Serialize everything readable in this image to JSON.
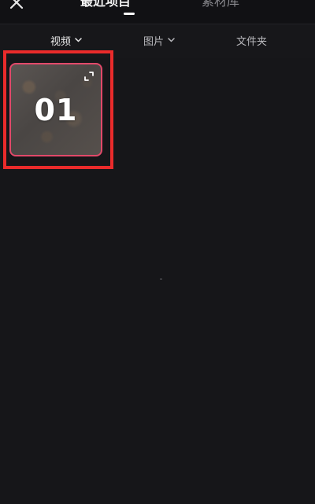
{
  "header": {
    "close_icon": "close-icon",
    "tabs": [
      {
        "label": "最近项目",
        "active": true
      },
      {
        "label": "素材库",
        "active": false
      }
    ]
  },
  "filters": [
    {
      "label": "视频",
      "active": true,
      "icon": "chevron-down-icon"
    },
    {
      "label": "图片",
      "active": false,
      "icon": "chevron-down-icon"
    },
    {
      "label": "文件夹",
      "active": false
    }
  ],
  "projects": [
    {
      "title": "01",
      "icon": "expand-icon",
      "selected": true
    }
  ],
  "colors": {
    "background": "#161619",
    "highlight": "#ea2b2b",
    "card_border": "#e2496a"
  }
}
